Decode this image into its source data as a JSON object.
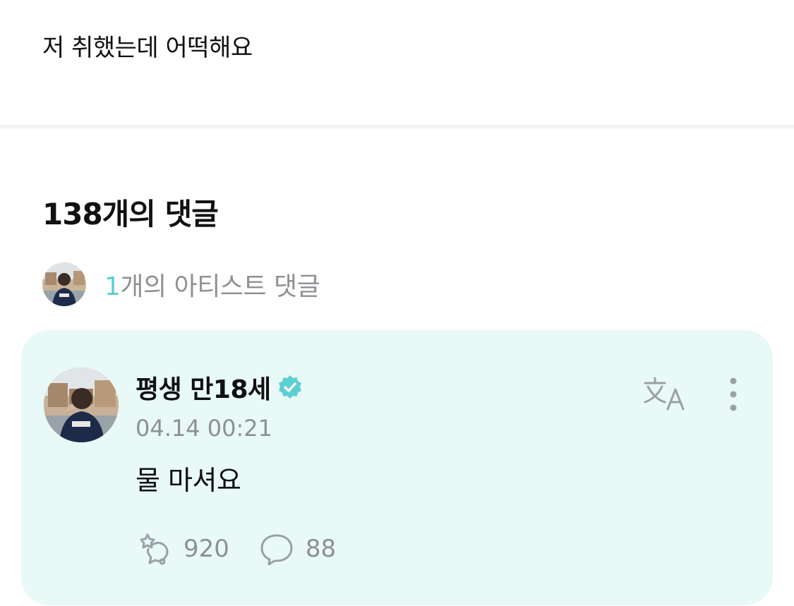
{
  "post": {
    "text": "저 취했는데 어떡해요"
  },
  "comments_header": {
    "title": "138개의 댓글"
  },
  "artist_comments": {
    "count": "1",
    "label": "개의 아티스트 댓글"
  },
  "comment": {
    "author": "평생 만18세",
    "timestamp": "04.14 00:21",
    "body": "물 마셔요",
    "likes": "920",
    "replies": "88"
  },
  "icons": {
    "verified": "verified-badge-icon",
    "translate": "translate-icon",
    "more": "more-vertical-icon",
    "like": "like-icon",
    "reply": "reply-bubble-icon"
  },
  "colors": {
    "accent": "#5ccfd1",
    "card_bg": "#e8f9f7",
    "muted": "#8e9094"
  }
}
